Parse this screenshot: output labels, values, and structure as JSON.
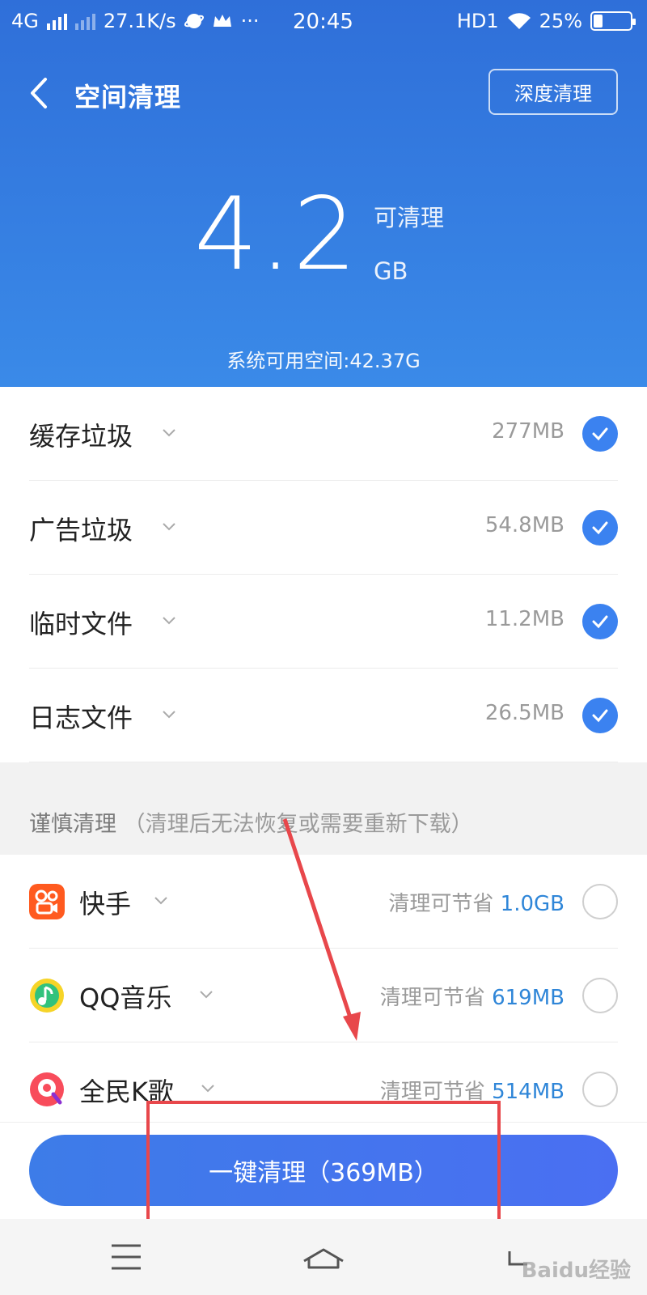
{
  "status_bar": {
    "network": "4G",
    "speed": "27.1K/s",
    "time": "20:45",
    "hd": "HD1",
    "battery": "25%",
    "battery_level": 0.25,
    "more": "···"
  },
  "header": {
    "title": "空间清理",
    "deep_clean_label": "深度清理",
    "cleanable_value": "4.2",
    "cleanable_label": "可清理",
    "cleanable_unit": "GB",
    "available_space": "系统可用空间:42.37G"
  },
  "junk_items": [
    {
      "label": "缓存垃圾",
      "size": "277MB",
      "checked": true
    },
    {
      "label": "广告垃圾",
      "size": "54.8MB",
      "checked": true
    },
    {
      "label": "临时文件",
      "size": "11.2MB",
      "checked": true
    },
    {
      "label": "日志文件",
      "size": "26.5MB",
      "checked": true
    }
  ],
  "caution": {
    "title": "谨慎清理",
    "subtitle": "（清理后无法恢复或需要重新下载）"
  },
  "apps": [
    {
      "name": "快手",
      "save_prefix": "清理可节省",
      "save_value": "1.0GB",
      "icon": "kuaishou-icon",
      "checked": false
    },
    {
      "name": "QQ音乐",
      "save_prefix": "清理可节省",
      "save_value": "619MB",
      "icon": "qq-music-icon",
      "checked": false
    },
    {
      "name": "全民K歌",
      "save_prefix": "清理可节省",
      "save_value": "514MB",
      "icon": "quanmin-kge-icon",
      "checked": false
    }
  ],
  "clean_button": "一键清理（369MB）",
  "watermark": "Baidu经验",
  "colors": {
    "header_top": "#2f6fd9",
    "header_bottom": "#3a8ae8",
    "accent": "#3b82f0",
    "value_blue": "#2f86d8",
    "annotation_red": "#e8474b"
  }
}
